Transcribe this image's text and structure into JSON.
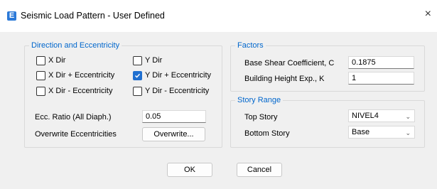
{
  "window": {
    "app_icon_letter": "E",
    "title": "Seismic Load Pattern - User Defined",
    "close_glyph": "×"
  },
  "direction_group": {
    "title": "Direction and Eccentricity",
    "checkboxes": [
      {
        "label": "X Dir",
        "checked": false
      },
      {
        "label": "X Dir + Eccentricity",
        "checked": false
      },
      {
        "label": "X Dir - Eccentricity",
        "checked": false
      },
      {
        "label": "Y Dir",
        "checked": false
      },
      {
        "label": "Y Dir + Eccentricity",
        "checked": true
      },
      {
        "label": "Y Dir - Eccentricity",
        "checked": false
      }
    ],
    "ecc_ratio_label": "Ecc. Ratio (All Diaph.)",
    "ecc_ratio_value": "0.05",
    "overwrite_label": "Overwrite Eccentricities",
    "overwrite_button": "Overwrite..."
  },
  "factors_group": {
    "title": "Factors",
    "base_shear_label": "Base Shear Coefficient, C",
    "base_shear_value": "0.1875",
    "height_exp_label": "Building Height Exp., K",
    "height_exp_value": "1"
  },
  "story_range_group": {
    "title": "Story Range",
    "top_story_label": "Top Story",
    "top_story_value": "NIVEL4",
    "bottom_story_label": "Bottom Story",
    "bottom_story_value": "Base"
  },
  "buttons": {
    "ok": "OK",
    "cancel": "Cancel"
  },
  "colors": {
    "accent": "#1f6fd0",
    "group_title": "#0066cc",
    "background": "#f0f0f0"
  }
}
